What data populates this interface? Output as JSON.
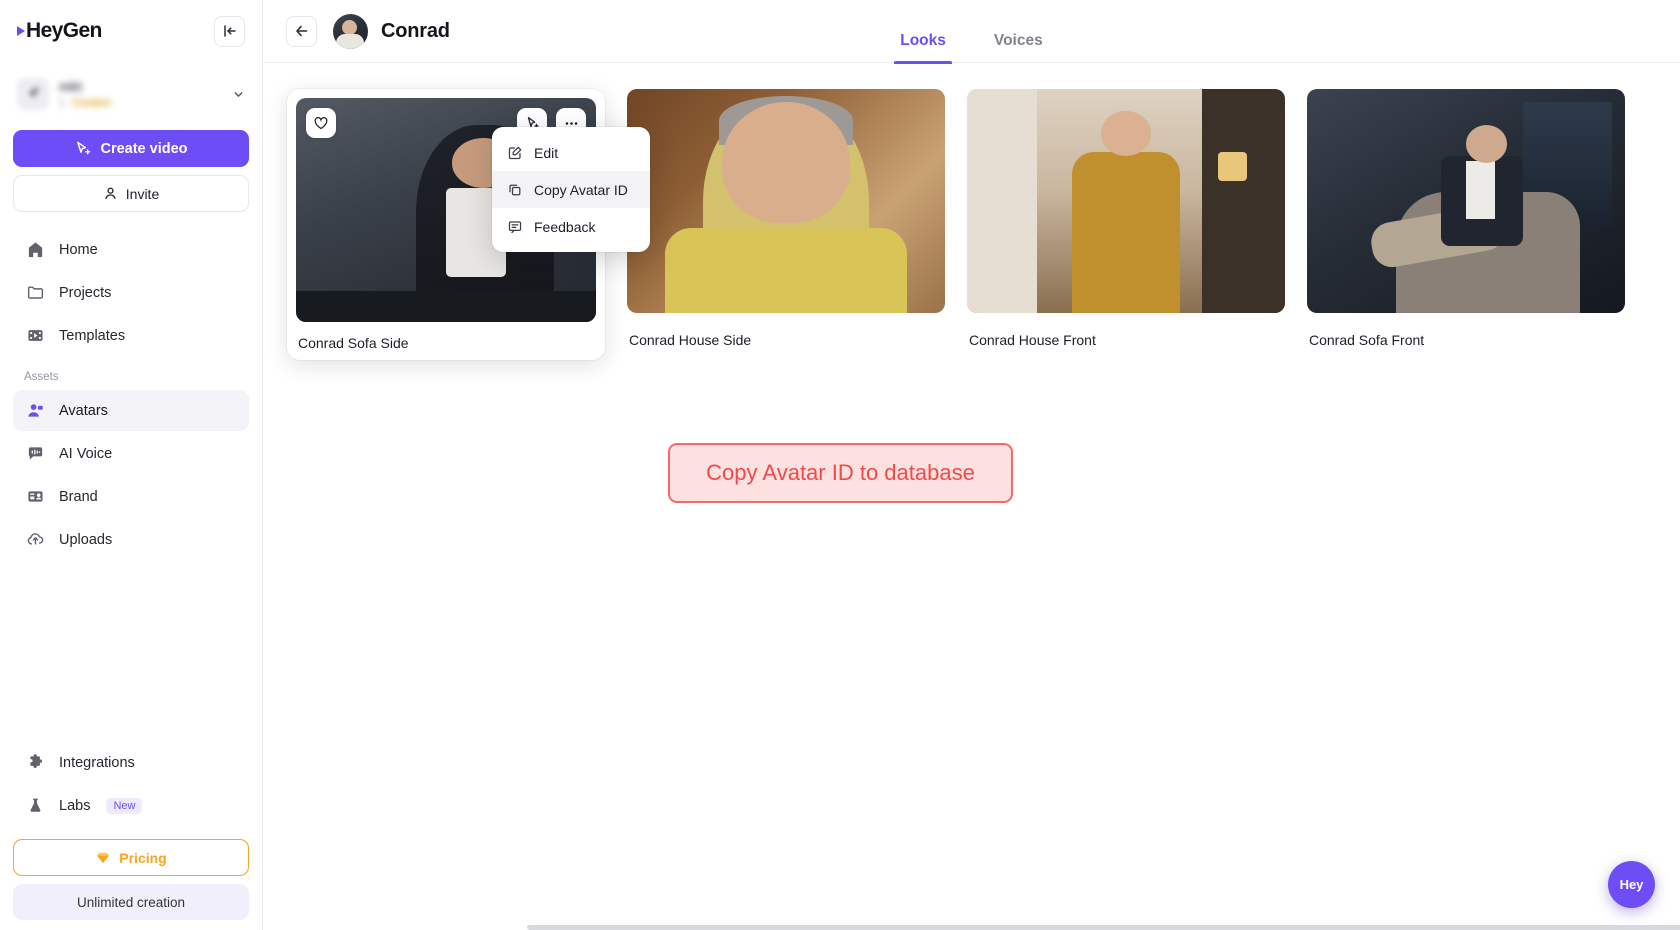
{
  "sidebar": {
    "logo": "HeyGen",
    "collapse_icon": "panel-collapse-icon",
    "workspace": {
      "name": "mkt",
      "members": "1",
      "plan": "Creator"
    },
    "create_button": "Create video",
    "invite_button": "Invite",
    "nav_items": [
      {
        "label": "Home",
        "icon": "home-icon",
        "name": "home",
        "active": false
      },
      {
        "label": "Projects",
        "icon": "folder-icon",
        "name": "projects",
        "active": false
      },
      {
        "label": "Templates",
        "icon": "film-icon",
        "name": "templates",
        "active": false
      }
    ],
    "section_label": "Assets",
    "asset_items": [
      {
        "label": "Avatars",
        "icon": "avatar-person-icon",
        "name": "avatars",
        "active": true
      },
      {
        "label": "AI Voice",
        "icon": "voice-bubble-icon",
        "name": "ai-voice",
        "active": false
      },
      {
        "label": "Brand",
        "icon": "brand-card-icon",
        "name": "brand",
        "active": false
      },
      {
        "label": "Uploads",
        "icon": "cloud-upload-icon",
        "name": "uploads",
        "active": false
      }
    ],
    "bottom_items": [
      {
        "label": "Integrations",
        "icon": "puzzle-icon",
        "name": "integrations",
        "badge": ""
      },
      {
        "label": "Labs",
        "icon": "flask-icon",
        "name": "labs",
        "badge": "New"
      }
    ],
    "pricing_button": "Pricing",
    "pricing_icon": "gem-icon",
    "unlimited_button": "Unlimited creation"
  },
  "topbar": {
    "back_icon": "arrow-left-icon",
    "avatar_name": "Conrad",
    "tabs": [
      {
        "label": "Looks",
        "name": "looks",
        "active": true
      },
      {
        "label": "Voices",
        "name": "voices",
        "active": false
      }
    ]
  },
  "cards": [
    {
      "label": "Conrad Sofa Side",
      "hovered": true,
      "art": "t1"
    },
    {
      "label": "Conrad House Side",
      "hovered": false,
      "art": "t2"
    },
    {
      "label": "Conrad House Front",
      "hovered": false,
      "art": "t3"
    },
    {
      "label": "Conrad Sofa Front",
      "hovered": false,
      "art": "t4"
    }
  ],
  "card_overlay": {
    "favorite_icon": "heart-icon",
    "create_video_icon": "cursor-plus-icon",
    "more_icon": "ellipsis-icon"
  },
  "context_menu": [
    {
      "label": "Edit",
      "icon": "pencil-square-icon",
      "name": "edit",
      "hovered": false
    },
    {
      "label": "Copy Avatar ID",
      "icon": "copy-icon",
      "name": "copy-avatar-id",
      "hovered": true
    },
    {
      "label": "Feedback",
      "icon": "message-icon",
      "name": "feedback",
      "hovered": false
    }
  ],
  "annotation": {
    "text": "Copy Avatar ID to database",
    "color": "#f04a4a",
    "background": "#fde0e0"
  },
  "fab": {
    "label": "Hey",
    "color": "#6c4df6"
  },
  "colors": {
    "accent": "#6c4df6",
    "pricing": "#f5a623",
    "annotation": "#f04a4a"
  }
}
